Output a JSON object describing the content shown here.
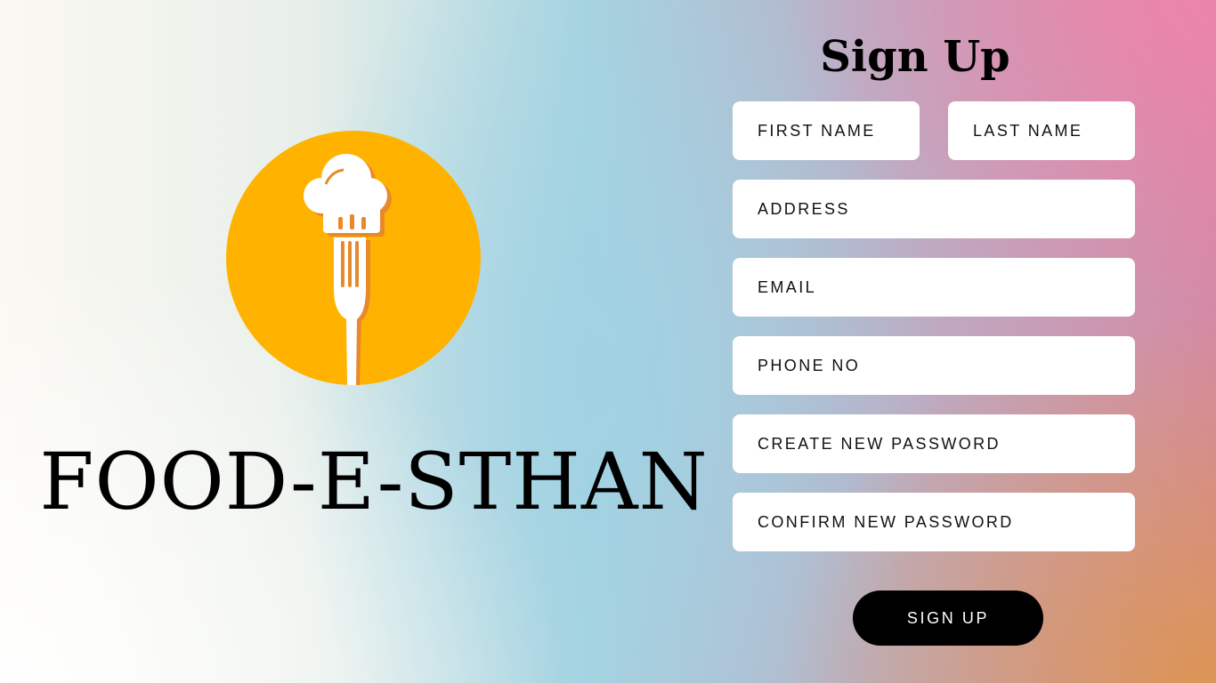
{
  "brand": {
    "name": "FOOD-E-STHAN",
    "logo_icon": "chef-hat-fork-icon",
    "logo_color": "#ffb300"
  },
  "form": {
    "title": "Sign Up",
    "fields": {
      "first_name": "FIRST NAME",
      "last_name": "LAST NAME",
      "address": "ADDRESS",
      "email": "EMAIL",
      "phone": "PHONE NO",
      "password": "CREATE NEW PASSWORD",
      "confirm_password": "CONFIRM NEW PASSWORD"
    },
    "submit_label": "SIGN UP"
  }
}
